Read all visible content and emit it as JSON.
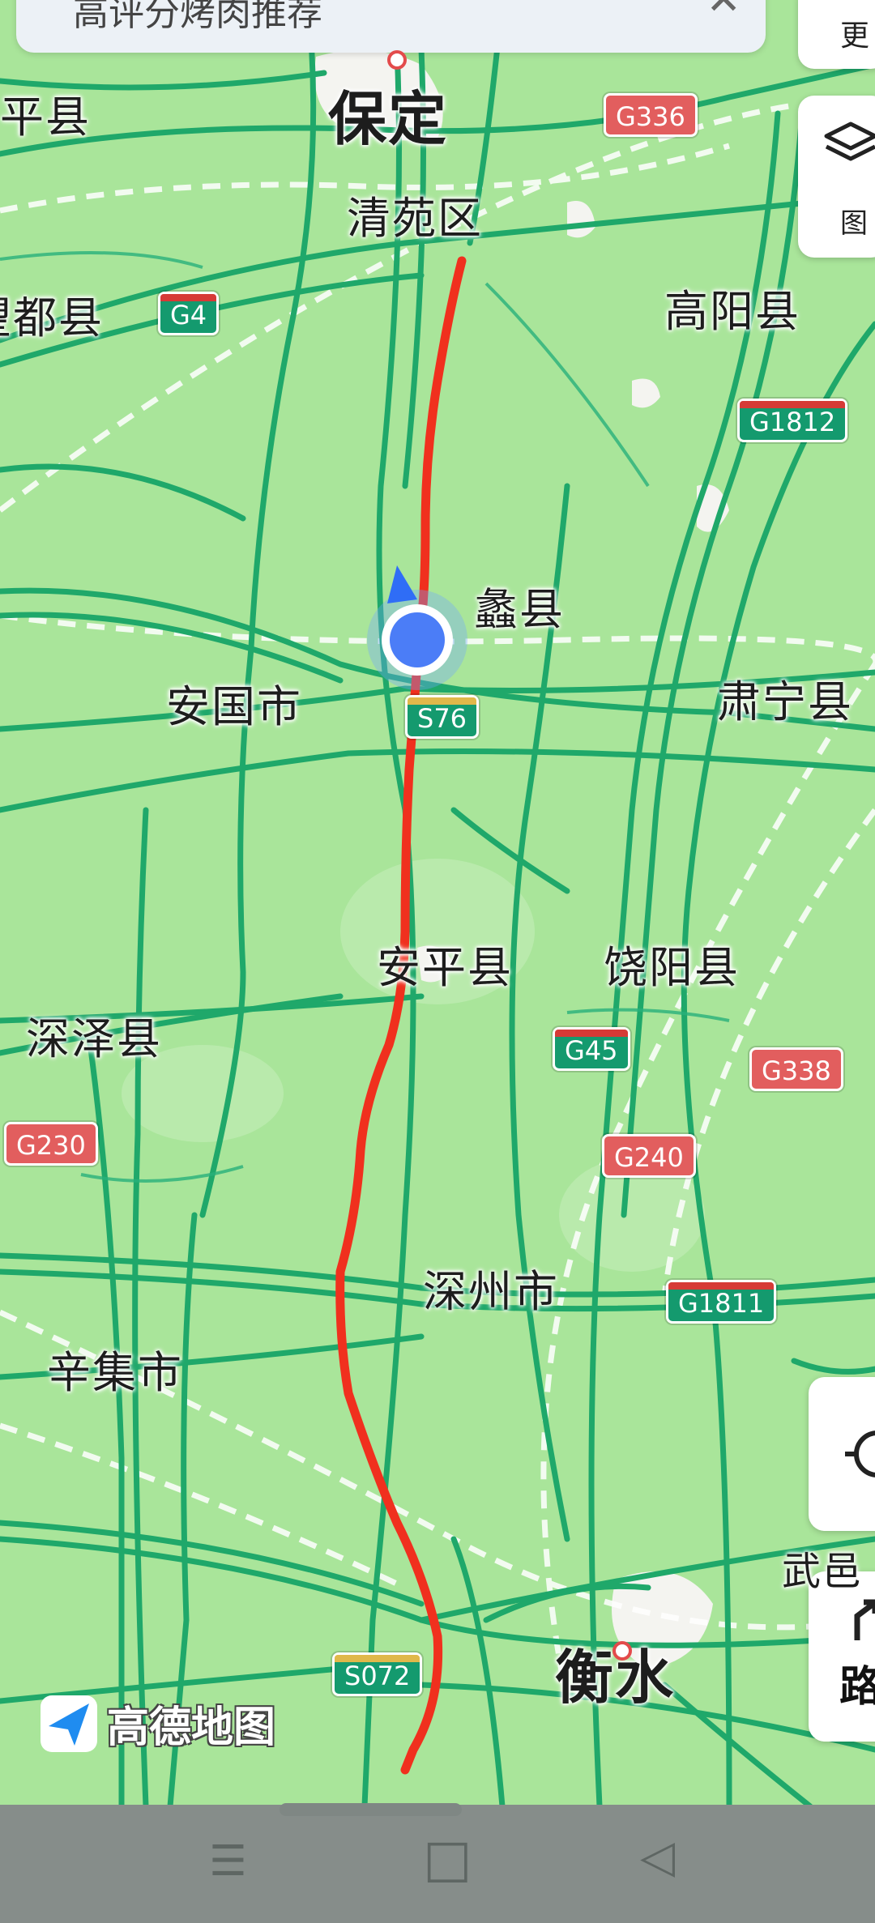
{
  "search": {
    "text": "高评分烤肉推荐",
    "close": "✕"
  },
  "places": {
    "pingxian": "平县",
    "baoding": "保定",
    "qingyuan": "清苑区",
    "wangdu": "望都县",
    "gaoyang": "高阳县",
    "lixian": "蠡县",
    "anguo": "安国市",
    "suning": "肃宁县",
    "anping": "安平县",
    "raoyang": "饶阳县",
    "shenze": "深泽县",
    "shenzhou": "深州市",
    "xinji": "辛集市",
    "hengshui": "衡水",
    "wuyi": "武邑"
  },
  "shields": {
    "g336": "G336",
    "g4": "G4",
    "g1812": "G1812",
    "s76": "S76",
    "g45": "G45",
    "g338": "G338",
    "g240": "G240",
    "g230": "G230",
    "g1811": "G1811",
    "s072": "S072"
  },
  "side_buttons": {
    "more": "更",
    "layers": "图",
    "route": "路"
  },
  "logo": {
    "text": "高德地图"
  },
  "nav": {
    "menu": "☰",
    "home": "□",
    "back": "◁"
  },
  "colors": {
    "map_bg": "#a9e59a",
    "road": "#1fa86a",
    "route": "#f0301e",
    "shield_green": "#149a6e",
    "shield_red": "#e25e5e"
  }
}
